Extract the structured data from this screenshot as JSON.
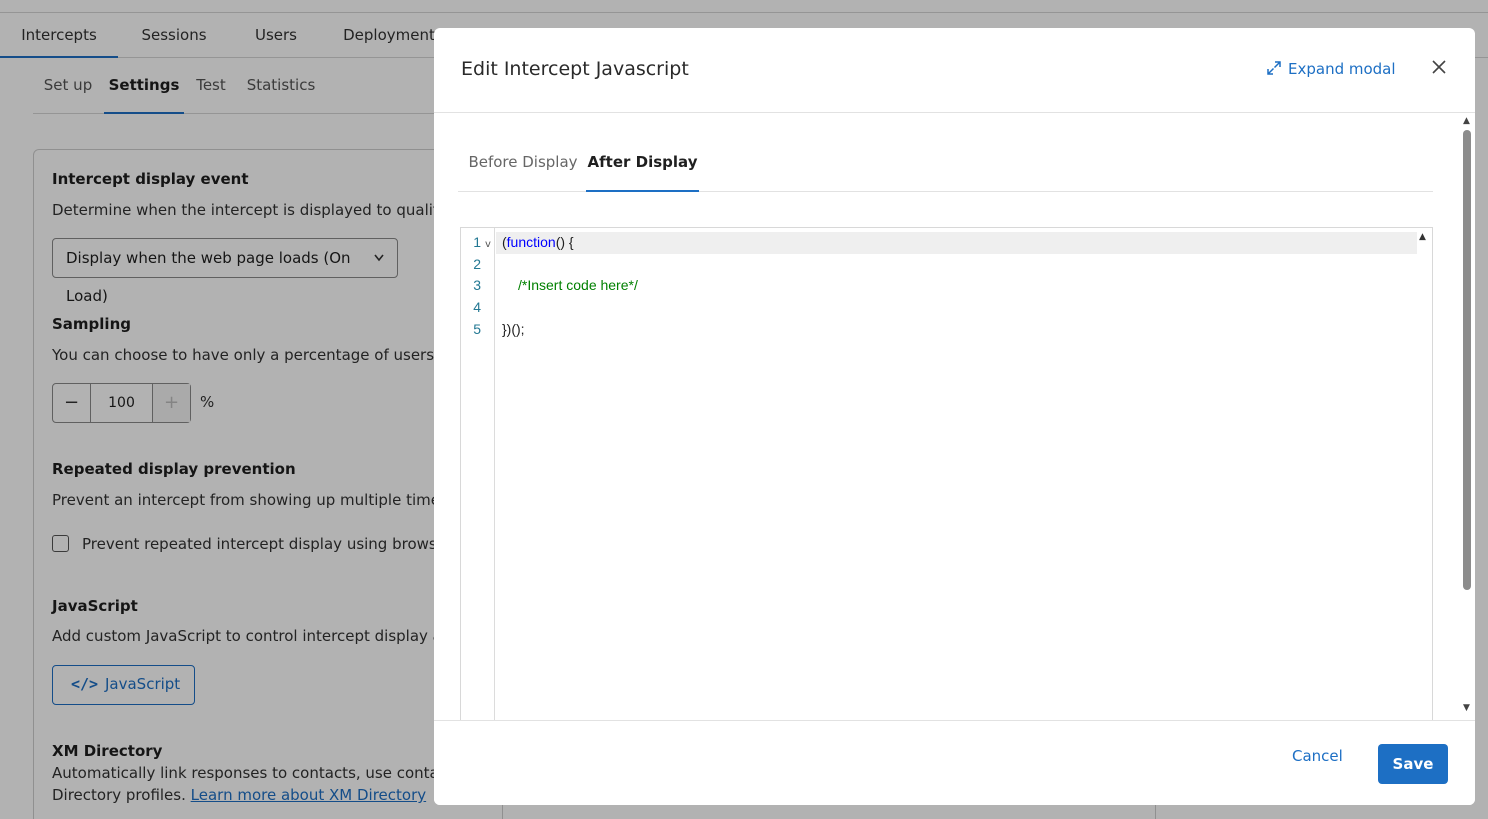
{
  "main_tabs": [
    "Intercepts",
    "Sessions",
    "Users",
    "Deployment"
  ],
  "sub_tabs": [
    "Set up",
    "Settings",
    "Test",
    "Statistics"
  ],
  "sections": {
    "display_event": {
      "title": "Intercept display event",
      "desc": "Determine when the intercept is displayed to qualified vis",
      "select_value": "Display when the web page loads (On Load)"
    },
    "sampling": {
      "title": "Sampling",
      "desc": "You can choose to have only a percentage of users to se",
      "value": "100",
      "unit": "%"
    },
    "repeat": {
      "title": "Repeated display prevention",
      "desc": "Prevent an intercept from showing up multiple times by p",
      "checkbox_label": "Prevent repeated intercept display using browser co"
    },
    "javascript": {
      "title": "JavaScript",
      "desc": "Add custom JavaScript to control intercept display and d",
      "button_icon": "</>",
      "button_label": "JavaScript"
    },
    "xm_directory": {
      "title": "XM Directory",
      "desc_line1": "Automatically link responses to contacts, use contact fre",
      "desc_line2": "Directory profiles.",
      "link": "Learn more about XM Directory"
    }
  },
  "modal": {
    "title": "Edit Intercept Javascript",
    "expand_label": "Expand modal",
    "tabs": [
      "Before Display",
      "After Display"
    ],
    "active_tab": "After Display",
    "code_lines": [
      {
        "num": "1",
        "text": "(function() {"
      },
      {
        "num": "2",
        "text": ""
      },
      {
        "num": "3",
        "text": "/*Insert code here*/"
      },
      {
        "num": "4",
        "text": ""
      },
      {
        "num": "5",
        "text": "})();"
      }
    ],
    "code_tokens": {
      "open_paren": "(",
      "keyword": "function",
      "open_rest": "() {",
      "comment": "/*Insert code here*/",
      "close": "})();"
    },
    "cancel_label": "Cancel",
    "save_label": "Save"
  },
  "colors": {
    "accent": "#1d6fc4",
    "keyword": "#0000ff",
    "comment": "#008000",
    "line_number": "#237893"
  },
  "icons": [
    "chevron-down-icon",
    "minus-icon",
    "plus-icon",
    "code-icon",
    "expand-icon",
    "close-icon",
    "fold-chevron-icon"
  ]
}
